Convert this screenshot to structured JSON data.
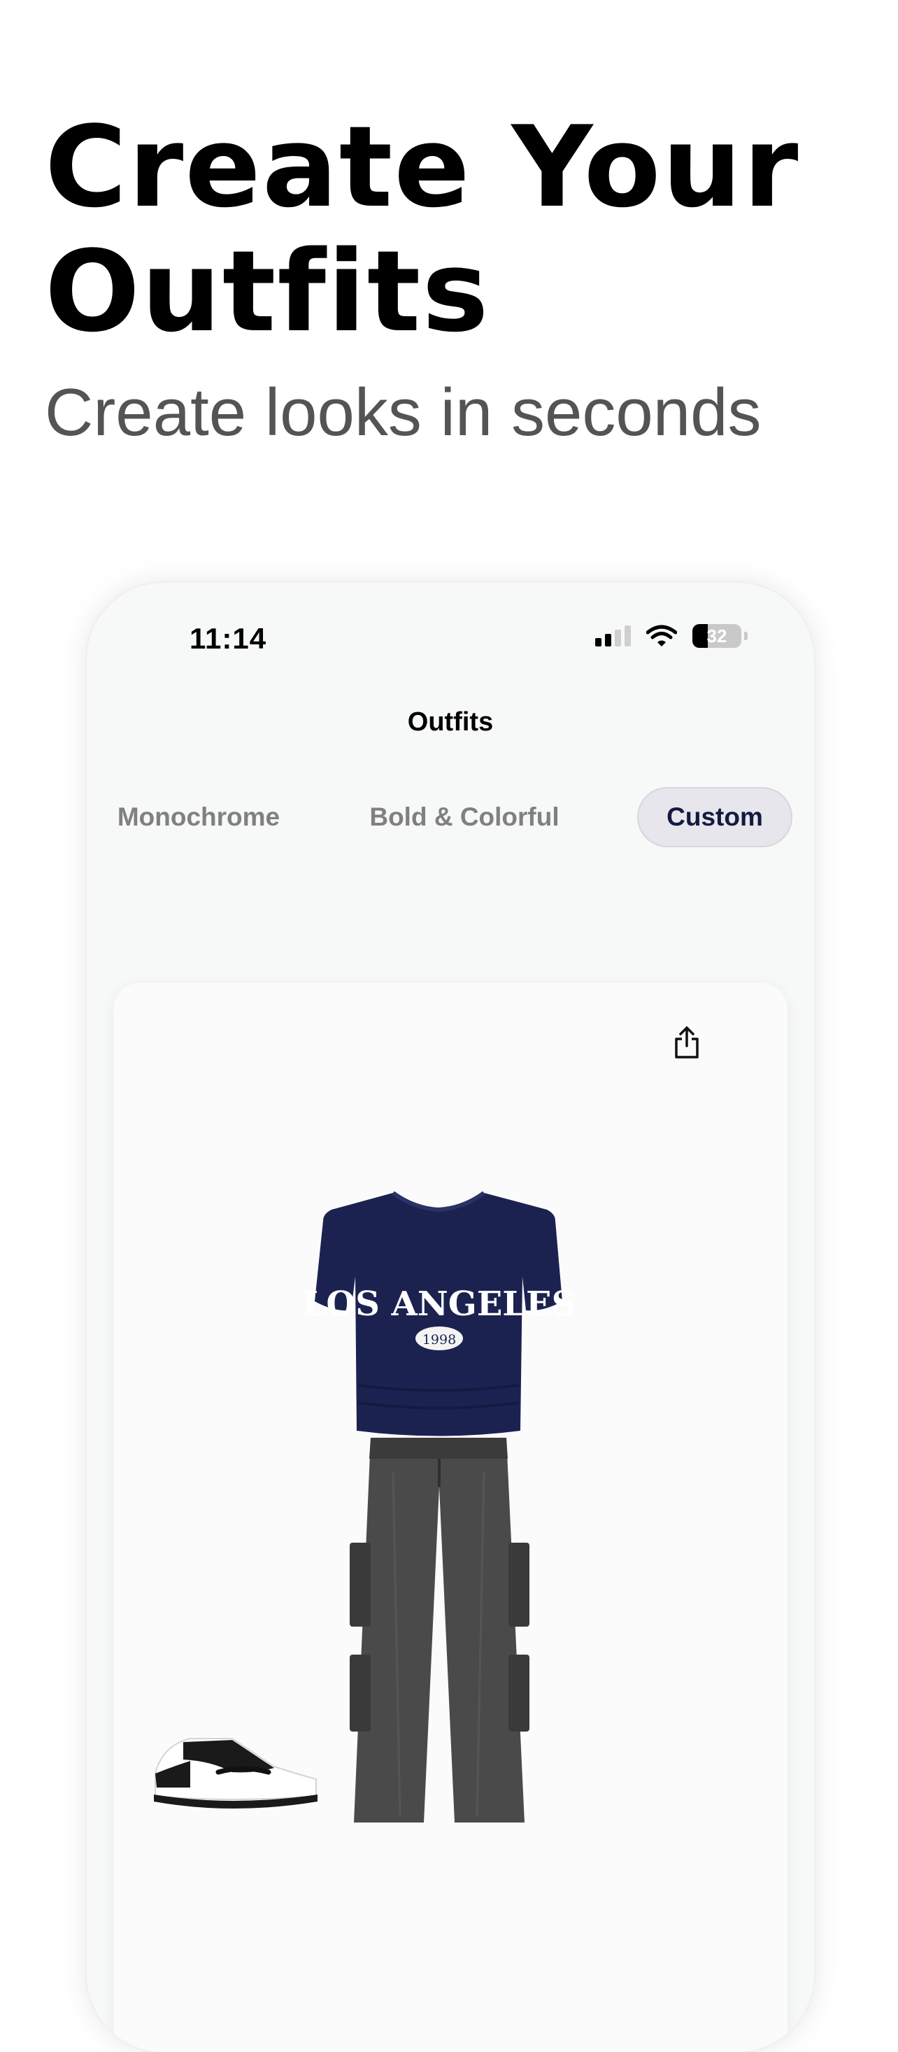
{
  "promo": {
    "title": "Create Your Outfits",
    "subtitle": "Create looks in seconds"
  },
  "status_bar": {
    "time": "11:14",
    "battery_level": "32",
    "battery_fraction": 0.32,
    "icons": [
      "signal-icon",
      "wifi-icon",
      "battery-icon"
    ]
  },
  "nav": {
    "title": "Outfits"
  },
  "tabs": [
    {
      "label": "Monochrome",
      "selected": false
    },
    {
      "label": "Bold & Colorful",
      "selected": false
    },
    {
      "label": "Custom",
      "selected": true
    }
  ],
  "outfit": {
    "share_icon": "share-icon",
    "items": [
      {
        "name": "t-shirt",
        "print_text": "LOS ANGELES",
        "print_year": "1998",
        "color": "#1c2250"
      },
      {
        "name": "cargo-jeans",
        "color": "#4a4a4a"
      },
      {
        "name": "sneaker",
        "color": "#1a1a1a"
      }
    ]
  },
  "colors": {
    "selected_tab_text": "#141a3f",
    "unselected_tab_text": "#808080",
    "selected_tab_bg": "#e6e6ec"
  }
}
